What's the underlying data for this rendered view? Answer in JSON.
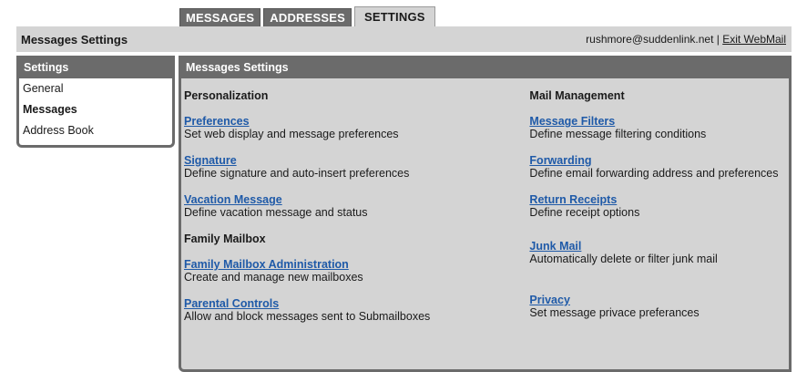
{
  "tabs": [
    {
      "label": "MESSAGES"
    },
    {
      "label": "ADDRESSES"
    },
    {
      "label": "SETTINGS"
    }
  ],
  "topbar": {
    "title": "Messages Settings",
    "email_text": "rushmore@suddenlink.net | ",
    "exit_label": "Exit WebMail"
  },
  "sidebar": {
    "header": "Settings",
    "items": [
      {
        "label": "General"
      },
      {
        "label": "Messages"
      },
      {
        "label": "Address Book"
      }
    ]
  },
  "main": {
    "header": "Messages Settings",
    "personalization": {
      "title": "Personalization",
      "items": [
        {
          "link": "Preferences",
          "desc": "Set web display and message preferences"
        },
        {
          "link": "Signature",
          "desc": "Define signature and auto-insert preferences"
        },
        {
          "link": "Vacation Message",
          "desc": "Define vacation message and status"
        }
      ]
    },
    "family": {
      "title": "Family Mailbox",
      "items": [
        {
          "link": "Family Mailbox Administration",
          "desc": "Create and manage new mailboxes"
        },
        {
          "link": "Parental Controls",
          "desc": "Allow and block messages sent to Submailboxes"
        }
      ]
    },
    "mail_management": {
      "title": "Mail Management",
      "items": [
        {
          "link": "Message Filters",
          "desc": "Define message filtering conditions"
        },
        {
          "link": "Forwarding",
          "desc": "Define email forwarding address and preferences"
        },
        {
          "link": "Return Receipts",
          "desc": "Define receipt options"
        },
        {
          "link": "Junk Mail",
          "desc": "Automatically delete or filter junk mail"
        },
        {
          "link": "Privacy",
          "desc": "Set message privace preferances"
        }
      ]
    }
  }
}
